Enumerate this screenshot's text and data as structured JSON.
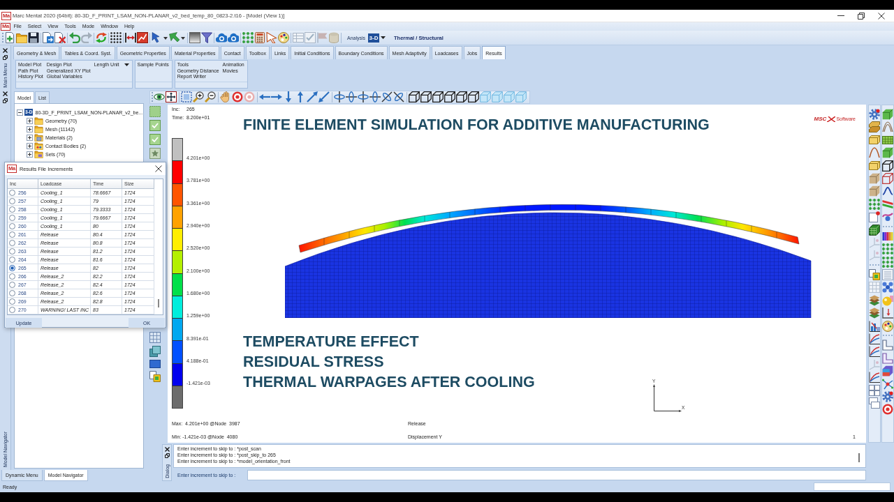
{
  "window": {
    "icon_text": "Ma",
    "title": "Marc Mentat 2020 (64bit): 80-3D_F_PRINT_LSAM_NON-PLANAR_v2_bed_temp_80_0823-2.t16 - [Model (View 1)]"
  },
  "menu_bar": {
    "icon_text": "Ma",
    "items": [
      "File",
      "Select",
      "View",
      "Tools",
      "Mode",
      "Window",
      "Help"
    ]
  },
  "toolbar": {
    "analysis_label": "Analysis",
    "dimension": "3-D",
    "analysis_class": "Thermal / Structural"
  },
  "main_menu": {
    "strip_label": "Main Menu",
    "tabs": [
      {
        "label": "Geometry & Mesh",
        "selected": false
      },
      {
        "label": "Tables & Coord. Syst.",
        "selected": false
      },
      {
        "label": "Geometric Properties",
        "selected": false
      },
      {
        "label": "Material Properties",
        "selected": false
      },
      {
        "label": "Contact",
        "selected": false
      },
      {
        "label": "Toolbox",
        "selected": false
      },
      {
        "label": "Links",
        "selected": false
      },
      {
        "label": "Initial Conditions",
        "selected": false
      },
      {
        "label": "Boundary Conditions",
        "selected": false
      },
      {
        "label": "Mesh Adaptivity",
        "selected": false
      },
      {
        "label": "Loadcases",
        "selected": false
      },
      {
        "label": "Jobs",
        "selected": false
      },
      {
        "label": "Results",
        "selected": true
      }
    ],
    "groups": [
      {
        "columns": [
          [
            "Model Plot",
            "Path Plot",
            "History Plot"
          ],
          [
            "Design Plot",
            "Generalized XY Plot",
            "Global Variables"
          ]
        ],
        "dropdown": "Length Unit"
      },
      {
        "columns": [
          [
            "Sample Points"
          ]
        ]
      },
      {
        "columns": [
          [
            "Tools",
            "Geometry Distance",
            "Report Writer"
          ],
          [
            "Animation",
            "Movies"
          ]
        ]
      }
    ]
  },
  "side_panel": {
    "strip_label": "Model Navigator",
    "tabs": [
      {
        "label": "Model",
        "selected": true
      },
      {
        "label": "List",
        "selected": false
      }
    ],
    "tree": [
      {
        "badge": "3-D",
        "label": "80-3D_F_PRINT_LSAM_NON-PLANAR_v2_be...",
        "expanded": true,
        "children": [
          {
            "label": "Geometry (70)",
            "expanded": false
          },
          {
            "label": "Mesh (11142)",
            "expanded": false
          },
          {
            "label": "Materials (2)",
            "expanded": false
          },
          {
            "label": "Contact Bodies (2)",
            "expanded": false
          },
          {
            "label": "Sets (70)",
            "expanded": false
          }
        ]
      }
    ],
    "bottom_tabs": [
      {
        "label": "Dynamic Menu",
        "selected": false
      },
      {
        "label": "Model Navigator",
        "selected": true
      }
    ]
  },
  "results_dialog": {
    "icon_text": "Ma",
    "title": "Results File Increments",
    "columns": [
      "Inc",
      "Loadcase",
      "Time",
      "Size"
    ],
    "rows": [
      {
        "inc": "256",
        "loadcase": "Cooling_1",
        "time": "78.6667",
        "size": "1724",
        "selected": false
      },
      {
        "inc": "257",
        "loadcase": "Cooling_1",
        "time": "79",
        "size": "1724",
        "selected": false
      },
      {
        "inc": "258",
        "loadcase": "Cooling_1",
        "time": "79.3333",
        "size": "1724",
        "selected": false
      },
      {
        "inc": "259",
        "loadcase": "Cooling_1",
        "time": "79.6667",
        "size": "1724",
        "selected": false
      },
      {
        "inc": "260",
        "loadcase": "Cooling_1",
        "time": "80",
        "size": "1724",
        "selected": false
      },
      {
        "inc": "261",
        "loadcase": "Release",
        "time": "80.4",
        "size": "1724",
        "selected": false
      },
      {
        "inc": "262",
        "loadcase": "Release",
        "time": "80.8",
        "size": "1724",
        "selected": false
      },
      {
        "inc": "263",
        "loadcase": "Release",
        "time": "81.2",
        "size": "1724",
        "selected": false
      },
      {
        "inc": "264",
        "loadcase": "Release",
        "time": "81.6",
        "size": "1724",
        "selected": false
      },
      {
        "inc": "265",
        "loadcase": "Release",
        "time": "82",
        "size": "1724",
        "selected": true
      },
      {
        "inc": "266",
        "loadcase": "Release_2",
        "time": "82.2",
        "size": "1724",
        "selected": false
      },
      {
        "inc": "267",
        "loadcase": "Release_2",
        "time": "82.4",
        "size": "1724",
        "selected": false
      },
      {
        "inc": "268",
        "loadcase": "Release_2",
        "time": "82.6",
        "size": "1724",
        "selected": false
      },
      {
        "inc": "269",
        "loadcase": "Release_2",
        "time": "82.8",
        "size": "1724",
        "selected": false
      },
      {
        "inc": "270",
        "loadcase": "WARNING! LAST INC",
        "time": "83",
        "size": "1724",
        "selected": false
      }
    ],
    "buttons": [
      "Update",
      "OK"
    ]
  },
  "viewport": {
    "inc_label": "Inc:",
    "inc": "265",
    "time_label": "Time:",
    "time": "8.200e+01",
    "title": "FINITE ELEMENT SIMULATION FOR ADDITIVE MANUFACTURING",
    "logo": {
      "mark": "MSC",
      "text": "Software"
    },
    "legend": {
      "bands": [
        {
          "color": "#c0c0c0"
        },
        {
          "color": "#ff0000"
        },
        {
          "color": "#ff5500"
        },
        {
          "color": "#ffa200"
        },
        {
          "color": "#ffee00"
        },
        {
          "color": "#b4f000"
        },
        {
          "color": "#00e04a"
        },
        {
          "color": "#00eedd"
        },
        {
          "color": "#00a8f0"
        },
        {
          "color": "#0050ff"
        },
        {
          "color": "#0000ee"
        },
        {
          "color": "#6c6c6c"
        }
      ],
      "labels": [
        "4.201e+00",
        "3.781e+00",
        "3.361e+00",
        "2.940e+00",
        "2.520e+00",
        "2.100e+00",
        "1.680e+00",
        "1.259e+00",
        "8.391e-01",
        "4.188e-01",
        "-1.421e-03"
      ]
    },
    "notes": [
      "TEMPERATURE EFFECT",
      "RESIDUAL STRESS",
      "THERMAL WARPAGES AFTER COOLING"
    ],
    "triad": {
      "y_label": "Y",
      "x_label": "X"
    },
    "max": "Max:  4.201e+00 @Node  3987",
    "min": "Min: -1.421e-03 @Node  4080",
    "loadcase": "Release",
    "quantity": "Displacement Y",
    "view_number": "1"
  },
  "dialog": {
    "strip_label": "Dialog",
    "log": [
      "Enter increment to skip to : *post_scan",
      "Enter increment to skip to : *post_skip_to 265",
      "Enter increment to skip to : *model_orientation_front"
    ],
    "prompt": "Enter increment to skip to :"
  },
  "status_bar": {
    "text": "Ready"
  }
}
